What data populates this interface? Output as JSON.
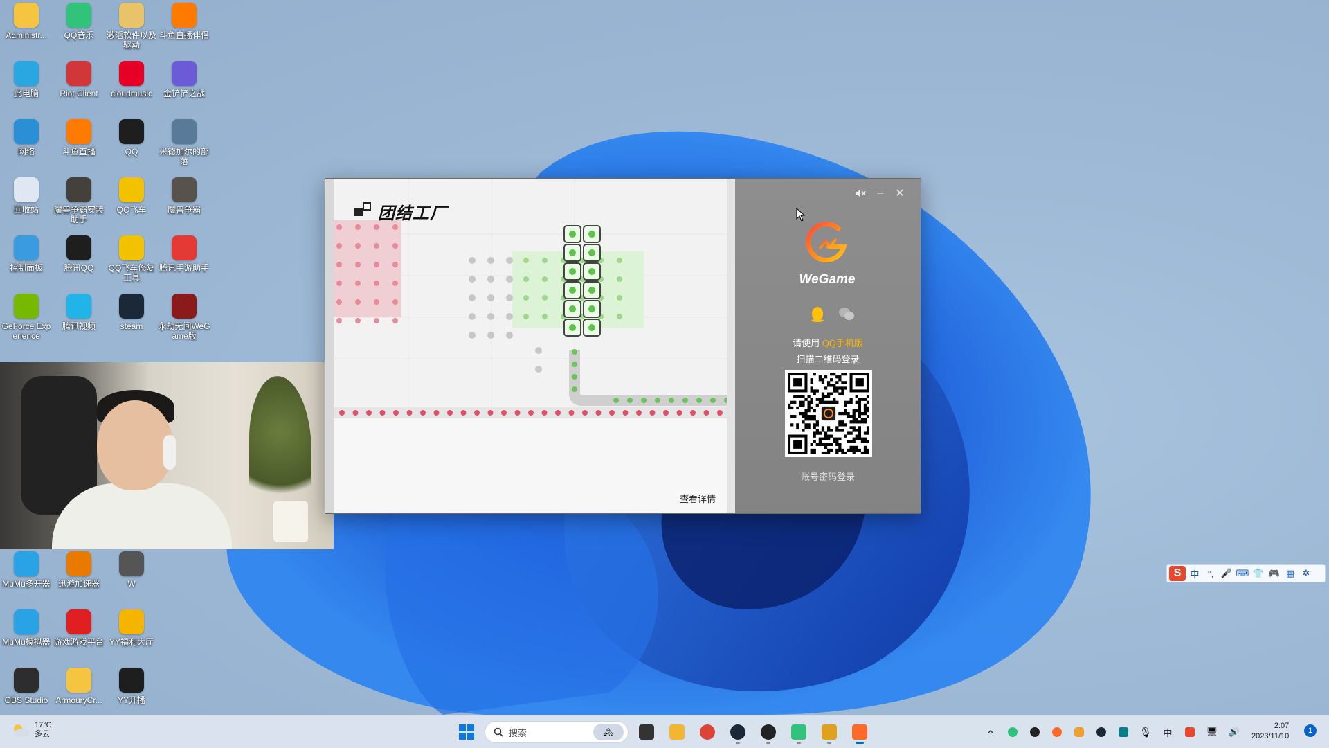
{
  "desktop": {
    "icons": [
      {
        "label": "Administr...",
        "icon": "folder-icon",
        "color": "#f5c542"
      },
      {
        "label": "QQ音乐",
        "icon": "qq-music-icon",
        "color": "#31c27c"
      },
      {
        "label": "激活软件以及驱动",
        "icon": "folder-icon",
        "color": "#e8c36a"
      },
      {
        "label": "斗鱼直播伴侣",
        "icon": "douyu-icon",
        "color": "#ff7a00"
      },
      {
        "label": "此电脑",
        "icon": "computer-icon",
        "color": "#2aa7e0"
      },
      {
        "label": "Riot Client",
        "icon": "riot-icon",
        "color": "#d13639"
      },
      {
        "label": "cloudmusic",
        "icon": "netease-music-icon",
        "color": "#e60026"
      },
      {
        "label": "金铲铲之战",
        "icon": "game-icon",
        "color": "#6b5bd6"
      },
      {
        "label": "网络",
        "icon": "network-icon",
        "color": "#2b8fd6"
      },
      {
        "label": "斗鱼直播",
        "icon": "douyu-icon",
        "color": "#ff7a00"
      },
      {
        "label": "QQ",
        "icon": "qq-icon",
        "color": "#1e1e1e"
      },
      {
        "label": "米德加尔的部落",
        "icon": "game-icon",
        "color": "#5a7a9a"
      },
      {
        "label": "回收站",
        "icon": "recycle-bin-icon",
        "color": "#dfe8f2"
      },
      {
        "label": "魔兽争霸安装助手",
        "icon": "warcraft-icon",
        "color": "#44403c"
      },
      {
        "label": "QQ飞车",
        "icon": "qq-speed-icon",
        "color": "#f2c200"
      },
      {
        "label": "魔兽争霸",
        "icon": "warcraft-icon",
        "color": "#58524c"
      },
      {
        "label": "控制面板",
        "icon": "control-panel-icon",
        "color": "#3a9be0"
      },
      {
        "label": "腾讯QQ",
        "icon": "qq-icon",
        "color": "#1e1e1e"
      },
      {
        "label": "QQ飞车修复工具",
        "icon": "qq-speed-icon",
        "color": "#f2c200"
      },
      {
        "label": "腾讯手游助手",
        "icon": "tencent-game-icon",
        "color": "#e53935"
      },
      {
        "label": "GeForce Experience",
        "icon": "nvidia-icon",
        "color": "#76b900"
      },
      {
        "label": "腾讯视频",
        "icon": "tencent-video-icon",
        "color": "#20b4e8"
      },
      {
        "label": "steam",
        "icon": "steam-icon",
        "color": "#1b2838"
      },
      {
        "label": "永劫无间WeGame版",
        "icon": "game-icon",
        "color": "#8b1b1b"
      },
      {
        "label": "MuMu多开器",
        "icon": "mumu-icon",
        "color": "#29a3e6"
      },
      {
        "label": "迅游加速器",
        "icon": "accelerator-icon",
        "color": "#e87a00"
      },
      {
        "label": "W",
        "icon": "app-icon",
        "color": "#555555"
      },
      {
        "label": "MuMu模拟器",
        "icon": "mumu-icon",
        "color": "#29a3e6"
      },
      {
        "label": "游戏游戏平台",
        "icon": "game-platform-icon",
        "color": "#e02020"
      },
      {
        "label": "YY福利大厅",
        "icon": "yy-icon",
        "color": "#f5b400"
      },
      {
        "label": "OBS Studio",
        "icon": "obs-icon",
        "color": "#2d2d2d"
      },
      {
        "label": "ArmouryCr...",
        "icon": "folder-icon",
        "color": "#f5c542"
      },
      {
        "label": "YY开播",
        "icon": "yy-icon",
        "color": "#1e1e1e"
      }
    ]
  },
  "launcher": {
    "ad": {
      "logo_text": "团结工厂",
      "detail_button": "查看详情"
    },
    "login": {
      "mute_icon": "speaker-mute-icon",
      "minimize": "–",
      "close": "✕",
      "brand": "WeGame",
      "hint_prefix": "请使用 ",
      "hint_highlight": "QQ手机版",
      "hint_line2": "扫描二维码登录",
      "account_login": "账号密码登录",
      "accent": "#ffb400"
    }
  },
  "ime": {
    "items": [
      "中",
      "°,",
      "🎤",
      "⌨",
      "👕",
      "🎮",
      "▦",
      "✲"
    ]
  },
  "taskbar": {
    "weather_temp": "17°C",
    "weather_desc": "多云",
    "search_placeholder": "搜索",
    "apps": [
      {
        "icon": "windows-start-icon",
        "state": ""
      },
      {
        "icon": "task-view-icon",
        "state": ""
      },
      {
        "icon": "file-explorer-icon",
        "state": ""
      },
      {
        "icon": "chrome-icon",
        "state": ""
      },
      {
        "icon": "steam-icon",
        "state": "running"
      },
      {
        "icon": "obs-icon",
        "state": "running"
      },
      {
        "icon": "qq-music-icon",
        "state": "running"
      },
      {
        "icon": "game-icon",
        "state": "running"
      },
      {
        "icon": "wegame-icon",
        "state": "active"
      }
    ],
    "time": "2:07",
    "date": "2023/11/10",
    "notification_count": "1"
  }
}
